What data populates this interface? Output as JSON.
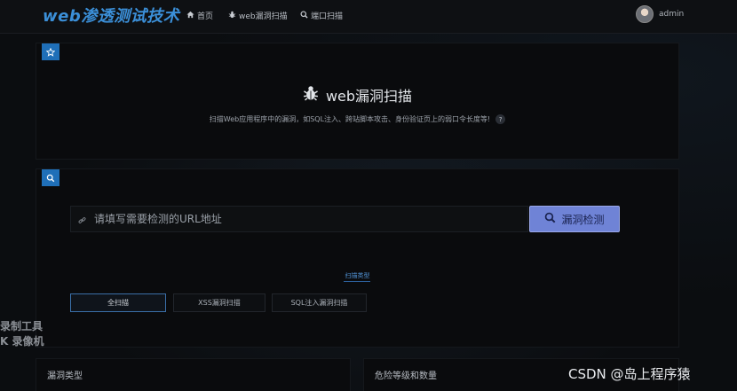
{
  "brand": "web渗透测试技术",
  "nav": [
    {
      "icon": "home-icon",
      "label": "首页"
    },
    {
      "icon": "bug-icon",
      "label": "web漏洞扫描"
    },
    {
      "icon": "search-icon",
      "label": "端口扫描"
    }
  ],
  "user": {
    "name": "admin"
  },
  "hero": {
    "title": "web漏洞扫描",
    "subtitle": "扫描Web应用程序中的漏洞，如SQL注入、跨站脚本攻击、身份验证页上的弱口令长度等!",
    "help": "?"
  },
  "search": {
    "placeholder": "请填写需要检测的URL地址",
    "button_label": "漏洞检测"
  },
  "scan_type": {
    "label": "扫描类型",
    "options": [
      "全扫描",
      "XSS漏洞扫描",
      "SQL注入漏洞扫描"
    ]
  },
  "overlay_left": [
    "录制工具",
    "K 录像机"
  ],
  "bottom_panels": [
    "漏洞类型",
    "危险等级和数量"
  ],
  "watermark": "CSDN @岛上程序猿",
  "colors": {
    "accent": "#1f6fb8",
    "button": "#6f83d6"
  }
}
